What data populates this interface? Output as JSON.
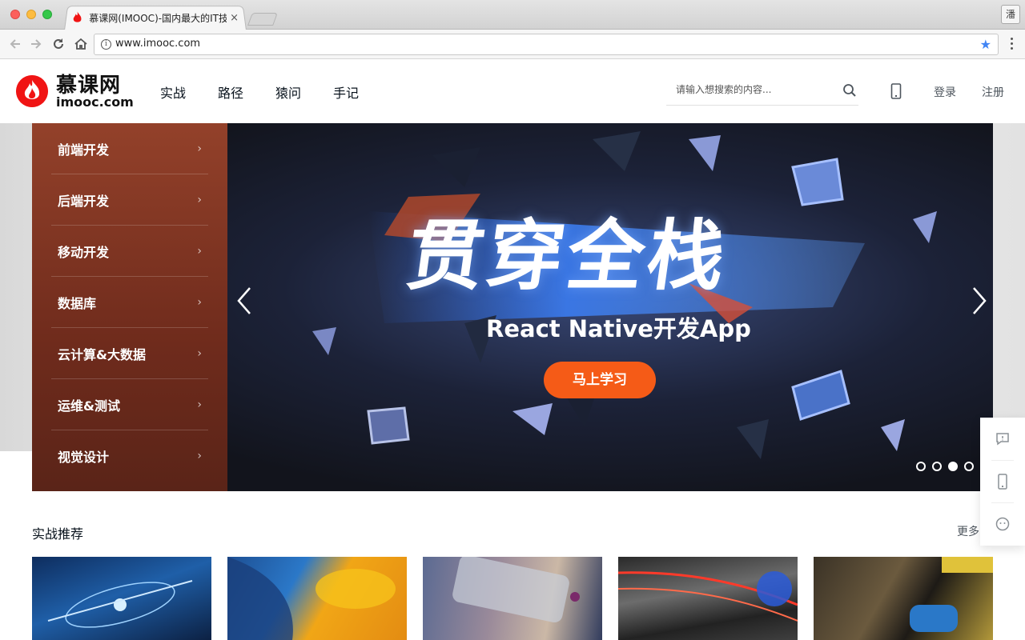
{
  "browser": {
    "tab_title": "慕课网(IMOOC)-国内最大的IT技",
    "tab_close": "×",
    "url": "www.imooc.com",
    "profile_label": "潘",
    "bookmark_star": "★"
  },
  "header": {
    "logo_cn": "慕课网",
    "logo_en": "imooc.com",
    "nav": [
      "实战",
      "路径",
      "猿问",
      "手记"
    ],
    "search_placeholder": "请输入想搜索的内容...",
    "login": "登录",
    "register": "注册"
  },
  "banner": {
    "menu": [
      "前端开发",
      "后端开发",
      "移动开发",
      "数据库",
      "云计算&大数据",
      "运维&测试",
      "视觉设计"
    ],
    "menu_arrow": "›",
    "title": "贯穿全栈",
    "subtitle": "React Native开发App",
    "cta": "马上学习",
    "dot_count": 4,
    "active_dot": 3
  },
  "section": {
    "title": "实战推荐",
    "more": "更多"
  },
  "colors": {
    "brand_red": "#f01414",
    "cta_orange": "#f55b17",
    "star_blue": "#4285f4"
  },
  "icons": [
    "back-arrow-icon",
    "forward-arrow-icon",
    "reload-icon",
    "home-icon",
    "info-icon",
    "star-icon",
    "search-icon",
    "phone-icon",
    "chevron-left-icon",
    "chevron-right-icon",
    "feedback-icon",
    "mobile-icon",
    "chat-icon"
  ]
}
